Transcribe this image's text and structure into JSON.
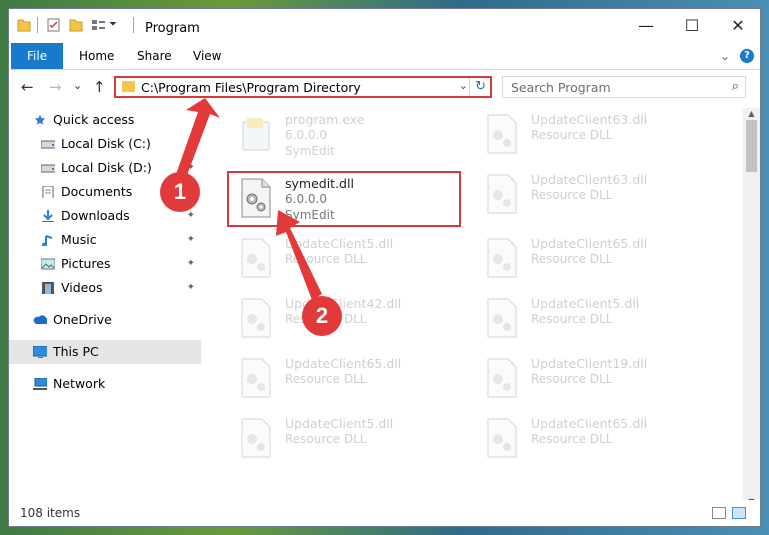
{
  "window": {
    "title": "Program",
    "controls": {
      "minimize": "—",
      "maximize": "☐",
      "close": "✕"
    }
  },
  "ribbon": {
    "tabs": [
      "File",
      "Home",
      "Share",
      "View"
    ],
    "help": "?"
  },
  "nav": {
    "back": "←",
    "forward": "→",
    "recent": "⌄",
    "up": "↑",
    "address": "C:\\Program Files\\Program Directory",
    "address_dropdown": "⌄",
    "refresh": "↻",
    "search_placeholder": "Search Program",
    "search_icon": "⌕"
  },
  "sidebar": {
    "items": [
      {
        "label": "Quick access",
        "icon": "star-icon",
        "pinned": false
      },
      {
        "label": "Local Disk (C:)",
        "icon": "drive-icon",
        "pinned": true
      },
      {
        "label": "Local Disk (D:)",
        "icon": "drive-icon",
        "pinned": true
      },
      {
        "label": "Documents",
        "icon": "document-icon",
        "pinned": true
      },
      {
        "label": "Downloads",
        "icon": "download-icon",
        "pinned": true
      },
      {
        "label": "Music",
        "icon": "music-icon",
        "pinned": true
      },
      {
        "label": "Pictures",
        "icon": "picture-icon",
        "pinned": true
      },
      {
        "label": "Videos",
        "icon": "video-icon",
        "pinned": true
      },
      {
        "label": "OneDrive",
        "icon": "cloud-icon",
        "pinned": false
      },
      {
        "label": "This PC",
        "icon": "computer-icon",
        "pinned": false,
        "selected": true
      },
      {
        "label": "Network",
        "icon": "network-icon",
        "pinned": false
      }
    ],
    "pin_glyph": "📌"
  },
  "files": {
    "left": [
      {
        "name": "program.exe",
        "line1": "6.0.0.0",
        "line2": "SymEdit",
        "kind": "exe",
        "faded": true
      },
      {
        "name": "symedit.dll",
        "line1": "6.0.0.0",
        "line2": "SymEdit",
        "kind": "dll",
        "faded": false
      },
      {
        "name": "UpdateClient5.dll",
        "line1": "Resource DLL",
        "line2": "",
        "kind": "dll",
        "faded": true
      },
      {
        "name": "UpdateClient42.dll",
        "line1": "Resource DLL",
        "line2": "",
        "kind": "dll",
        "faded": true
      },
      {
        "name": "UpdateClient65.dll",
        "line1": "Resource DLL",
        "line2": "",
        "kind": "dll",
        "faded": true
      },
      {
        "name": "UpdateClient5.dll",
        "line1": "Resource DLL",
        "line2": "",
        "kind": "dll",
        "faded": true
      }
    ],
    "right": [
      {
        "name": "UpdateClient63.dll",
        "line1": "Resource DLL",
        "line2": "",
        "kind": "dll",
        "faded": true
      },
      {
        "name": "UpdateClient63.dll",
        "line1": "Resource DLL",
        "line2": "",
        "kind": "dll",
        "faded": true
      },
      {
        "name": "UpdateClient65.dll",
        "line1": "Resource DLL",
        "line2": "",
        "kind": "dll",
        "faded": true
      },
      {
        "name": "UpdateClient5.dll",
        "line1": "Resource DLL",
        "line2": "",
        "kind": "dll",
        "faded": true
      },
      {
        "name": "UpdateClient19.dll",
        "line1": "Resource DLL",
        "line2": "",
        "kind": "dll",
        "faded": true
      },
      {
        "name": "UpdateClient65.dll",
        "line1": "Resource DLL",
        "line2": "",
        "kind": "dll",
        "faded": true
      }
    ]
  },
  "status": {
    "item_count": "108 items"
  },
  "annotations": {
    "callout_1": "1",
    "callout_2": "2",
    "color": "#e23a3a"
  }
}
